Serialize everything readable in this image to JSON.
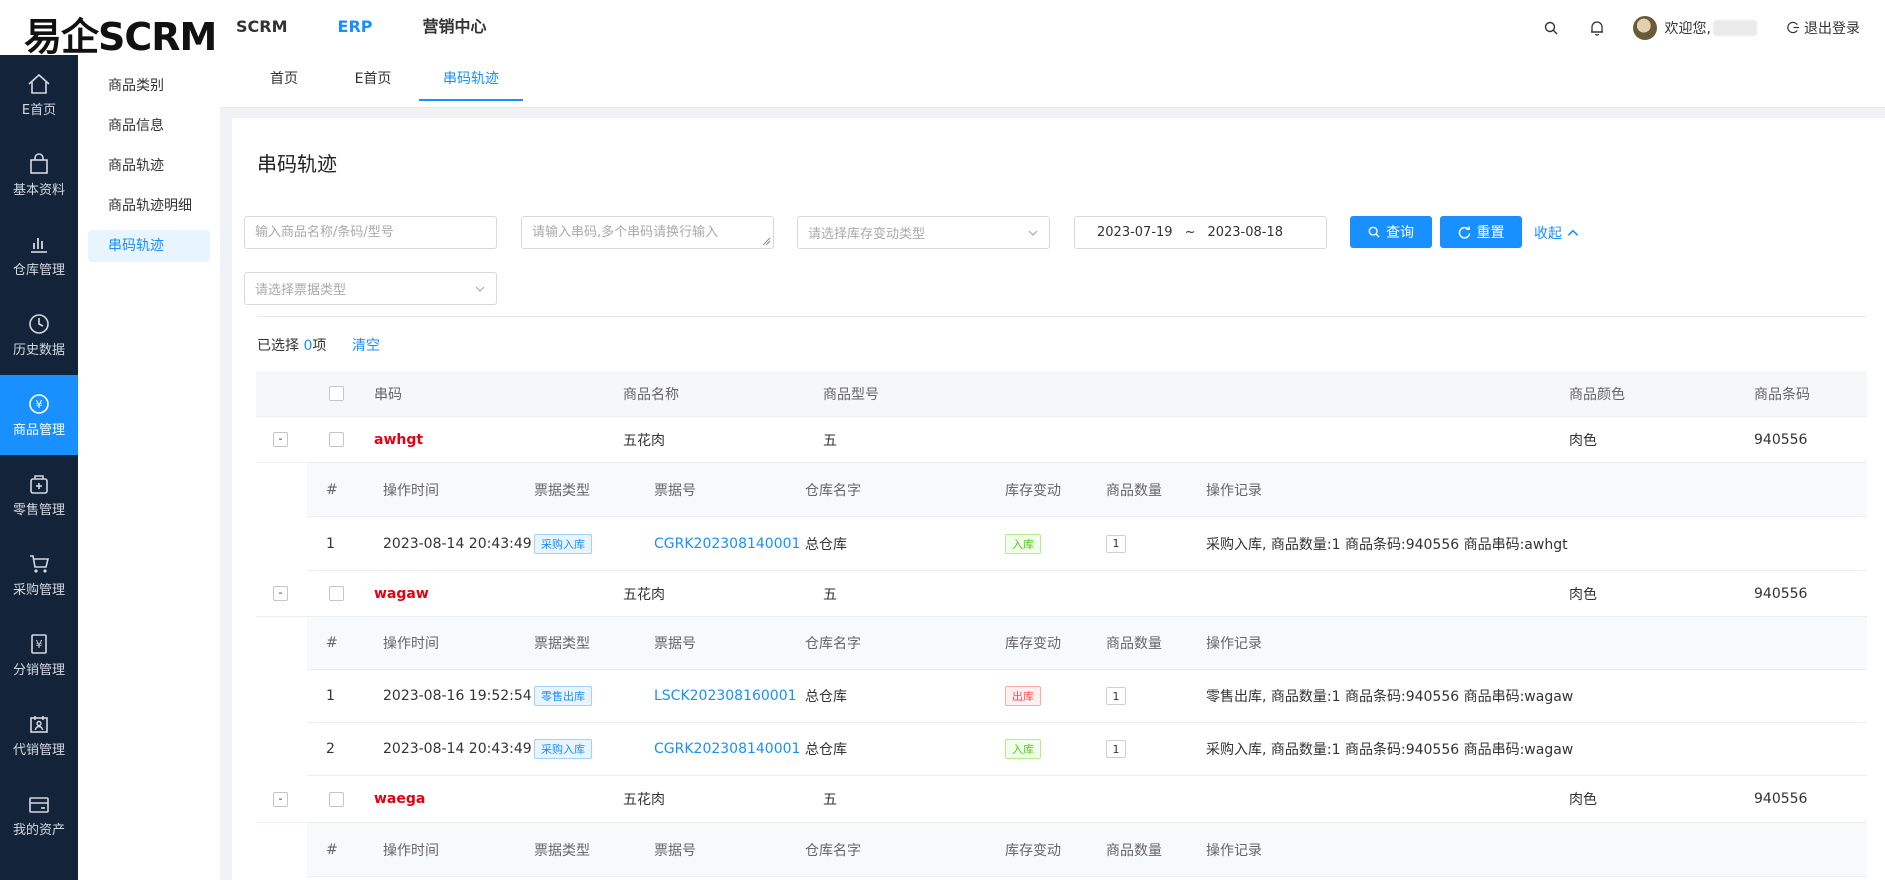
{
  "header": {
    "logo": "易企SCRM",
    "nav": [
      {
        "label": "SCRM",
        "active": false
      },
      {
        "label": "ERP",
        "active": true
      },
      {
        "label": "营销中心",
        "active": false
      }
    ],
    "welcome": "欢迎您,",
    "logout": "退出登录",
    "icons": [
      "search-icon",
      "bell-icon",
      "logout-icon"
    ]
  },
  "sidebar": {
    "items": [
      {
        "label": "E首页",
        "icon": "home-icon",
        "active": false
      },
      {
        "label": "基本资料",
        "icon": "bag-icon",
        "active": false
      },
      {
        "label": "仓库管理",
        "icon": "bar-chart-icon",
        "active": false
      },
      {
        "label": "历史数据",
        "icon": "clock-icon",
        "active": false
      },
      {
        "label": "商品管理",
        "icon": "yen-circle-icon",
        "active": true
      },
      {
        "label": "零售管理",
        "icon": "retail-icon",
        "active": false
      },
      {
        "label": "采购管理",
        "icon": "cart-icon",
        "active": false
      },
      {
        "label": "分销管理",
        "icon": "yen-doc-icon",
        "active": false
      },
      {
        "label": "代销管理",
        "icon": "person-board-icon",
        "active": false
      },
      {
        "label": "我的资产",
        "icon": "wallet-icon",
        "active": false
      }
    ]
  },
  "submenu": {
    "items": [
      {
        "label": "商品类别",
        "active": false
      },
      {
        "label": "商品信息",
        "active": false
      },
      {
        "label": "商品轨迹",
        "active": false
      },
      {
        "label": "商品轨迹明细",
        "active": false
      },
      {
        "label": "串码轨迹",
        "active": true
      }
    ]
  },
  "tabs": [
    {
      "label": "首页",
      "active": false
    },
    {
      "label": "E首页",
      "active": false
    },
    {
      "label": "串码轨迹",
      "active": true
    }
  ],
  "page": {
    "title": "串码轨迹",
    "filters": {
      "product_placeholder": "输入商品名称/条码/型号",
      "serial_placeholder": "请输入串码,多个串码请换行输入",
      "stock_type_placeholder": "请选择库存变动类型",
      "date_start": "2023-07-19",
      "date_sep": "~",
      "date_end": "2023-08-18",
      "bill_type_placeholder": "请选择票据类型",
      "query_label": "查询",
      "reset_label": "重置",
      "collapse_label": "收起"
    },
    "selection": {
      "prefix": "已选择 ",
      "count": "0",
      "suffix": "项",
      "clear_label": "清空"
    },
    "table": {
      "columns": {
        "serial": "串码",
        "name": "商品名称",
        "model": "商品型号",
        "color": "商品颜色",
        "barcode": "商品条码"
      },
      "sub_columns": {
        "idx": "#",
        "time": "操作时间",
        "bill_type": "票据类型",
        "bill_no": "票据号",
        "warehouse": "仓库名字",
        "stock_change": "库存变动",
        "qty": "商品数量",
        "log": "操作记录"
      },
      "rows": [
        {
          "serial": "awhgt",
          "name": "五花肉",
          "model": "五",
          "color": "肉色",
          "barcode": "940556",
          "expand": "-",
          "records": [
            {
              "idx": "1",
              "time": "2023-08-14 20:43:49",
              "bill_type": "采购入库",
              "bill_type_color": "blue",
              "bill_no": "CGRK202308140001",
              "warehouse": "总仓库",
              "stock_change": "入库",
              "stock_color": "green",
              "qty": "1",
              "log": "采购入库, 商品数量:1 商品条码:940556 商品串码:awhgt"
            }
          ]
        },
        {
          "serial": "wagaw",
          "name": "五花肉",
          "model": "五",
          "color": "肉色",
          "barcode": "940556",
          "expand": "-",
          "records": [
            {
              "idx": "1",
              "time": "2023-08-16 19:52:54",
              "bill_type": "零售出库",
              "bill_type_color": "blue",
              "bill_no": "LSCK202308160001",
              "warehouse": "总仓库",
              "stock_change": "出库",
              "stock_color": "red",
              "qty": "1",
              "log": "零售出库, 商品数量:1 商品条码:940556 商品串码:wagaw"
            },
            {
              "idx": "2",
              "time": "2023-08-14 20:43:49",
              "bill_type": "采购入库",
              "bill_type_color": "blue",
              "bill_no": "CGRK202308140001",
              "warehouse": "总仓库",
              "stock_change": "入库",
              "stock_color": "green",
              "qty": "1",
              "log": "采购入库, 商品数量:1 商品条码:940556 商品串码:wagaw"
            }
          ]
        },
        {
          "serial": "waega",
          "name": "五花肉",
          "model": "五",
          "color": "肉色",
          "barcode": "940556",
          "expand": "-",
          "records": []
        }
      ]
    }
  }
}
